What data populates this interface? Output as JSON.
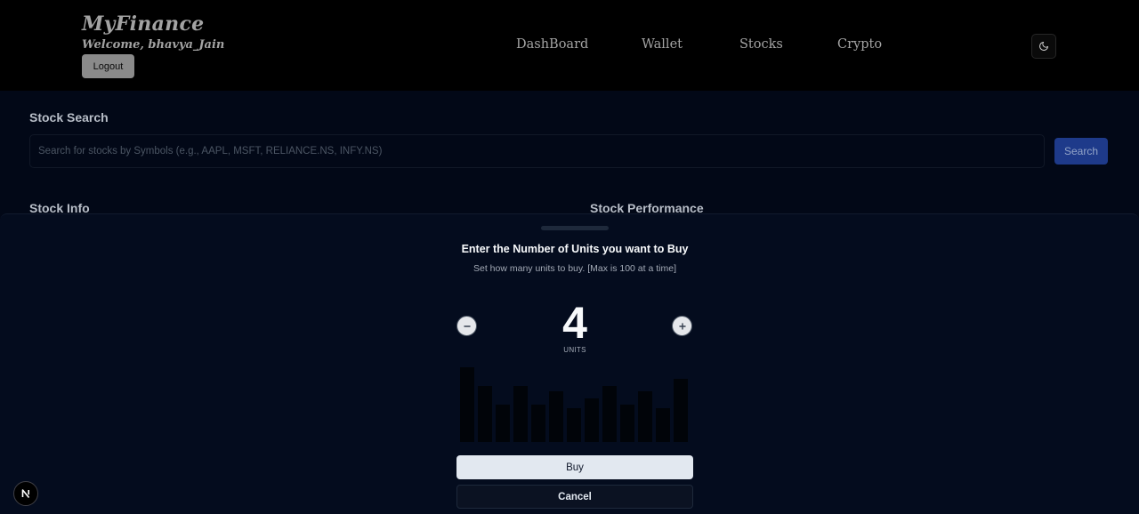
{
  "header": {
    "brand": "MyFinance",
    "welcome": "Welcome, bhavya_Jain",
    "logout_label": "Logout",
    "nav": [
      {
        "label": "DashBoard"
      },
      {
        "label": "Wallet"
      },
      {
        "label": "Stocks"
      },
      {
        "label": "Crypto"
      }
    ],
    "theme_toggle_icon": "moon-icon"
  },
  "search": {
    "title": "Stock Search",
    "placeholder": "Search for stocks by Symbols (e.g., AAPL, MSFT, RELIANCE.NS, INFY.NS)",
    "value": "",
    "button_label": "Search"
  },
  "sections": {
    "stock_info": "Stock Info",
    "stock_performance": "Stock Performance"
  },
  "drawer": {
    "title": "Enter the Number of Units you want to Buy",
    "description": "Set how many units to buy. [Max is 100 at a time]",
    "units_value": "4",
    "units_label": "UNITS",
    "decrement_icon": "minus-icon",
    "increment_icon": "plus-icon",
    "buy_label": "Buy",
    "cancel_label": "Cancel",
    "bar_levels": [
      1.0,
      0.75,
      0.5,
      0.75,
      0.5,
      0.68,
      0.45,
      0.58,
      0.75,
      0.5,
      0.68,
      0.45,
      0.85
    ]
  },
  "colors": {
    "background": "#020817",
    "header_background": "#000000",
    "accent_blue": "#1e3a8a",
    "buy_button": "#e2e8f0"
  },
  "badge_icon": "nextjs-logo-icon"
}
